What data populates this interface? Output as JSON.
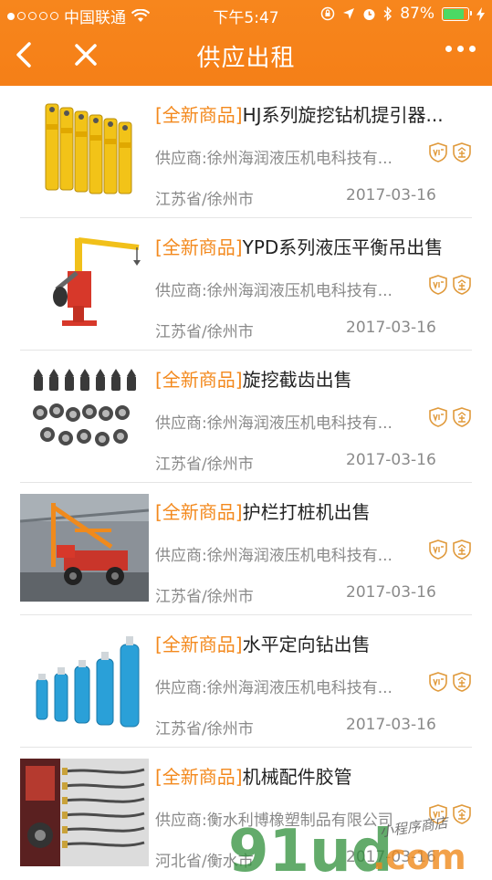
{
  "status_bar": {
    "carrier": "中国联通",
    "time": "下午5:47",
    "battery": "87%"
  },
  "nav": {
    "title": "供应出租"
  },
  "colors": {
    "accent": "#f57f17",
    "tag": "#f3891d",
    "text": "#222222",
    "muted": "#8a8a8a"
  },
  "items": [
    {
      "tag": "[全新商品]",
      "name": "HJ系列旋挖钻机提引器...",
      "supplier": "供应商:徐州海润液压机电科技有...",
      "location": "江苏省/徐州市",
      "date": "2017-03-16",
      "image": "yellow-extractor"
    },
    {
      "tag": "[全新商品]",
      "name": "YPD系列液压平衡吊出售",
      "supplier": "供应商:徐州海润液压机电科技有...",
      "location": "江苏省/徐州市",
      "date": "2017-03-16",
      "image": "balance-crane"
    },
    {
      "tag": "[全新商品]",
      "name": "旋挖截齿出售",
      "supplier": "供应商:徐州海润液压机电科技有...",
      "location": "江苏省/徐州市",
      "date": "2017-03-16",
      "image": "cutting-teeth"
    },
    {
      "tag": "[全新商品]",
      "name": "护栏打桩机出售",
      "supplier": "供应商:徐州海润液压机电科技有...",
      "location": "江苏省/徐州市",
      "date": "2017-03-16",
      "image": "pile-driver"
    },
    {
      "tag": "[全新商品]",
      "name": "水平定向钻出售",
      "supplier": "供应商:徐州海润液压机电科技有...",
      "location": "江苏省/徐州市",
      "date": "2017-03-16",
      "image": "blue-drills"
    },
    {
      "tag": "[全新商品]",
      "name": "机械配件胶管",
      "supplier": "供应商:衡水利博橡塑制品有限公司",
      "location": "河北省/衡水市",
      "date": "2017-03-16",
      "image": "rubber-hoses"
    }
  ],
  "badges": [
    "certified-icon",
    "enterprise-icon"
  ],
  "watermark": {
    "brand": "91ud.com",
    "caption": "小程序商店"
  }
}
